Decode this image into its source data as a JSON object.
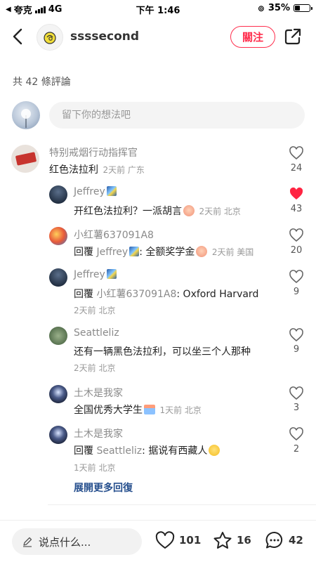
{
  "status_bar": {
    "carrier": "夸克",
    "network": "4G",
    "time": "下午 1:46",
    "battery": "35%",
    "battery_fraction": 0.35
  },
  "header": {
    "username": "ssssecond",
    "follow_label": "關注"
  },
  "comments_header": {
    "count_text": "共 42 條評論"
  },
  "input": {
    "placeholder": "留下你的想法吧"
  },
  "main_comment": {
    "user": "特别戒烟行动指挥官",
    "text": "红色法拉利",
    "meta": "2天前 广东",
    "likes": "24"
  },
  "replies": [
    {
      "user": "Jeffrey",
      "text": "开红色法拉利？一派胡言",
      "meta": "2天前 北京",
      "likes": "43",
      "liked": true
    },
    {
      "user": "小红薯637091A8",
      "prefix": "回覆 ",
      "ref": "Jeffrey",
      "text": ": 全额奖学金",
      "meta": "2天前 美国",
      "likes": "20"
    },
    {
      "user": "Jeffrey",
      "prefix": "回覆 ",
      "ref": "小红薯637091A8",
      "text": ": Oxford Harvard",
      "meta": "2天前 北京",
      "likes": "9"
    },
    {
      "user": "Seattleliz",
      "text": "还有一辆黑色法拉利，可以坐三个人那种",
      "meta": "2天前 北京",
      "likes": "9"
    },
    {
      "user": "土木是我家",
      "text": "全国优秀大学生",
      "meta": "1天前 北京",
      "likes": "3"
    },
    {
      "user": "土木是我家",
      "prefix": "回覆 ",
      "ref": "Seattleliz",
      "text": ": 据说有西藏人",
      "meta": "1天前 北京",
      "likes": "2"
    }
  ],
  "expand_label": "展開更多回復",
  "bottom_bar": {
    "placeholder": "说点什么...",
    "likes": "101",
    "stars": "16",
    "comments": "42"
  },
  "colors": {
    "accent": "#ff2e4d",
    "link": "#27508e",
    "liked": "#ff2442"
  }
}
